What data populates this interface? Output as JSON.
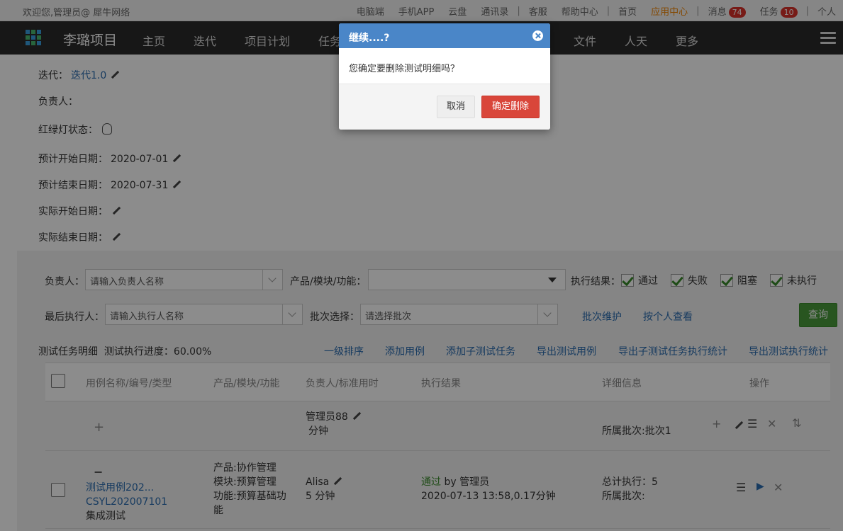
{
  "topbar": {
    "welcome": "欢迎您,管理员@ 犀牛网络",
    "links": [
      "电脑端",
      "手机APP",
      "云盘",
      "通讯录"
    ],
    "links2": [
      "客服",
      "帮助中心"
    ],
    "home": "首页",
    "app_center": "应用中心",
    "messages_label": "消息",
    "messages_count": "74",
    "tasks_label": "任务",
    "tasks_count": "10",
    "personal": "个人"
  },
  "nav": {
    "brand": "李璐项目",
    "items": [
      "主页",
      "迭代",
      "项目计划",
      "任务",
      "文件",
      "人天",
      "更多"
    ]
  },
  "info": {
    "iteration_label": "迭代：",
    "iteration_value": "迭代1.0",
    "owner_label": "负责人：",
    "light_label": "红绿灯状态：",
    "plan_start_label": "预计开始日期：",
    "plan_start_value": "2020-07-01",
    "plan_end_label": "预计结束日期：",
    "plan_end_value": "2020-07-31",
    "actual_start_label": "实际开始日期：",
    "actual_end_label": "实际结束日期："
  },
  "filter": {
    "owner_label": "负责人：",
    "owner_placeholder": "请输入负责人名称",
    "product_label": "产品/模块/功能：",
    "result_label": "执行结果：",
    "results": [
      "通过",
      "失败",
      "阻塞",
      "未执行"
    ],
    "last_exec_label": "最后执行人：",
    "last_exec_placeholder": "请输入执行人名称",
    "batch_label": "批次选择：",
    "batch_placeholder": "请选择批次",
    "batch_maintain": "批次维护",
    "by_person": "按个人查看",
    "query": "查询"
  },
  "summary": {
    "title": "测试任务明细",
    "progress": "测试执行进度：60.00%"
  },
  "actions": [
    "一级排序",
    "添加用例",
    "添加子测试任务",
    "导出测试用例",
    "导出子测试任务执行统计",
    "导出测试执行统计"
  ],
  "table": {
    "headers": [
      "用例名称/编号/类型",
      "产品/模块/功能",
      "负责人/标准用时",
      "执行结果",
      "详细信息",
      "操作"
    ],
    "group_row": {
      "plus": "+",
      "owner": "管理员88",
      "duration": "分钟",
      "batch": "所属批次:批次1"
    },
    "case_row": {
      "minus": "−",
      "name": "测试用例202...",
      "code": "CSYL202007101",
      "type": "集成测试",
      "product": "产品:协作管理",
      "module": "模块:预算管理",
      "function": "功能:预算基础功",
      "function2": "能",
      "owner": "Alisa",
      "duration": "5 分钟",
      "result_status": "通过",
      "result_by": " by 管理员",
      "result_time": "2020-07-13 13:58,0.17分钟",
      "total_exec": "总计执行：5",
      "batch": "所属批次:"
    }
  },
  "modal": {
    "title": "继续....?",
    "message": "您确定要删除测试明细吗？",
    "cancel": "取消",
    "confirm": "确定删除"
  }
}
